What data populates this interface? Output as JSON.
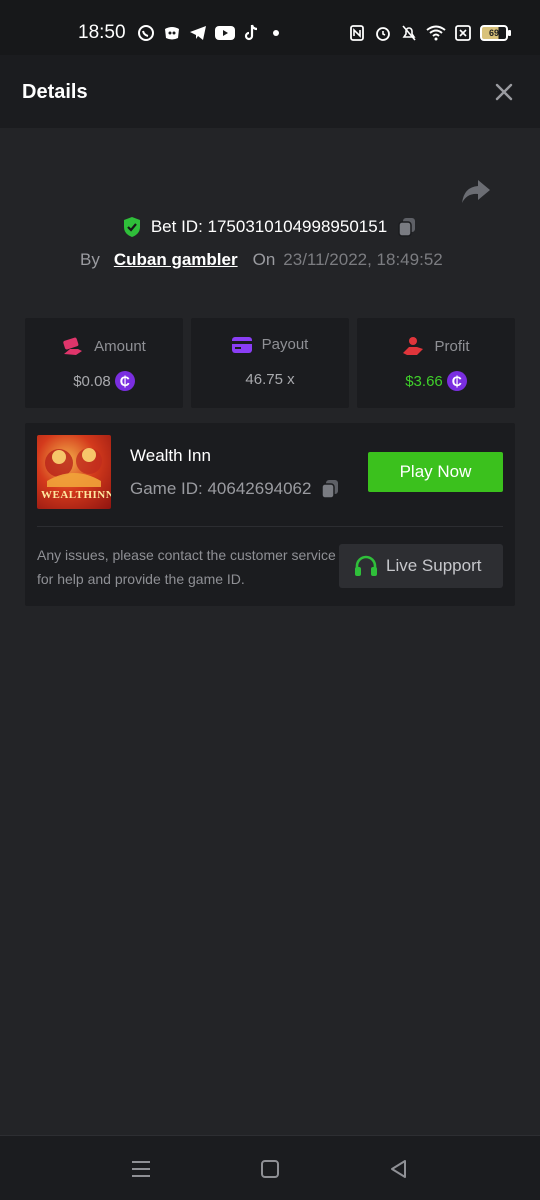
{
  "status_bar": {
    "time": "18:50",
    "app_icons": [
      "whatsapp-icon",
      "discord-icon",
      "telegram-icon",
      "youtube-icon",
      "tiktok-icon",
      "dot-icon"
    ],
    "right_icons": [
      "nfc-icon",
      "alarm-icon",
      "mute-icon",
      "wifi-icon",
      "sim-icon"
    ],
    "battery": "69"
  },
  "header": {
    "title": "Details"
  },
  "bet": {
    "id_text": "Bet ID: 1750310104998950151",
    "by_label": "By",
    "username": "Cuban gambler",
    "on_label": "On",
    "date": "23/11/2022, 18:49:52"
  },
  "stats": {
    "amount": {
      "label": "Amount",
      "value": "$0.08"
    },
    "payout": {
      "label": "Payout",
      "value": "46.75 x"
    },
    "profit": {
      "label": "Profit",
      "value": "$3.66"
    },
    "coin_symbol": "₵"
  },
  "game": {
    "thumb_text": "WEALTHINN",
    "name": "Wealth Inn",
    "id_text": "Game ID: 40642694062",
    "play_label": "Play Now",
    "issue_text": "Any issues, please contact the customer service for help and provide the game ID.",
    "support_label": "Live Support"
  },
  "colors": {
    "accent_green": "#3bc11d",
    "profit_green": "#3fcf2a",
    "coin_purple": "#7a2ee0",
    "shield_green": "#2fbf3a"
  }
}
